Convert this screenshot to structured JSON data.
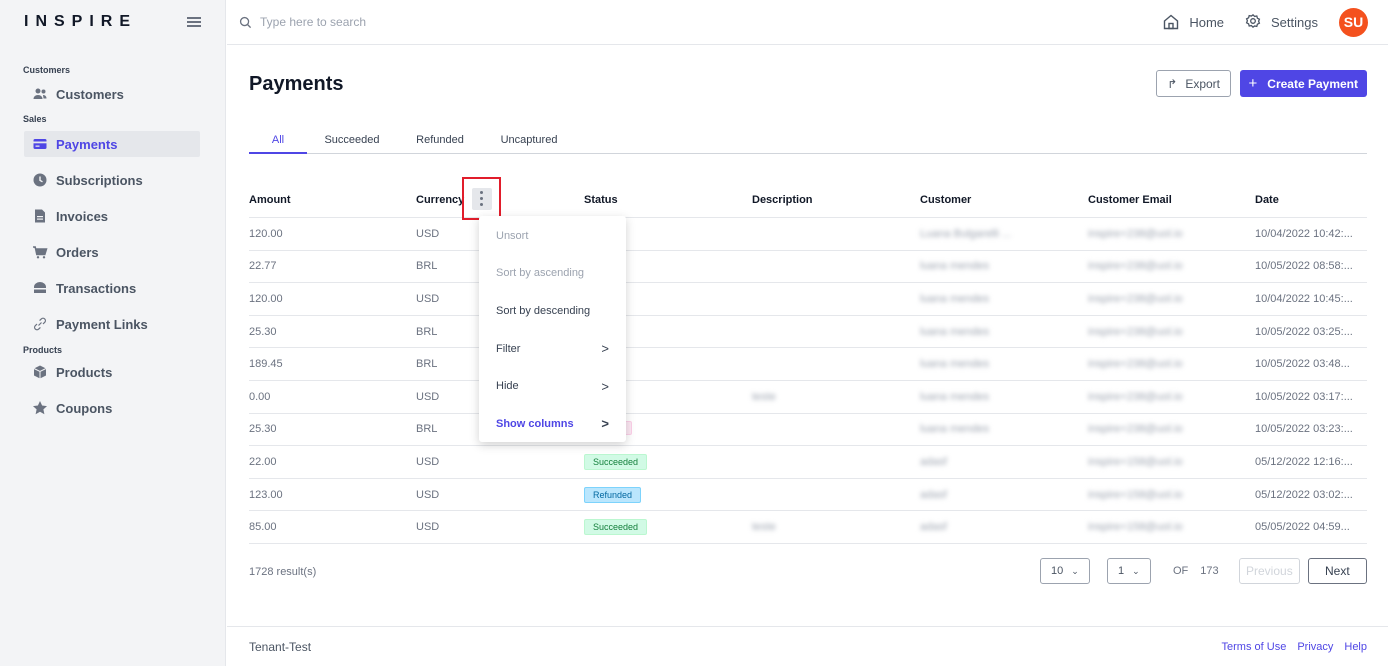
{
  "brand": {
    "logo_pre": "IN",
    "logo_post": "SPIRE"
  },
  "sidebar": {
    "section_customers": "Customers",
    "customers": "Customers",
    "section_sales": "Sales",
    "payments": "Payments",
    "subscriptions": "Subscriptions",
    "invoices": "Invoices",
    "orders": "Orders",
    "transactions": "Transactions",
    "payment_links": "Payment Links",
    "section_products": "Products",
    "products": "Products",
    "coupons": "Coupons"
  },
  "header": {
    "search_placeholder": "Type here to search",
    "home": "Home",
    "settings": "Settings",
    "avatar": "SU"
  },
  "page": {
    "title": "Payments",
    "export": "Export",
    "create": "Create Payment",
    "tabs": [
      "All",
      "Succeeded",
      "Refunded",
      "Uncaptured"
    ]
  },
  "table": {
    "headers": [
      "Amount",
      "Currency",
      "Status",
      "Description",
      "Customer",
      "Customer Email",
      "Date"
    ],
    "rows": [
      {
        "amount": "120.00",
        "currency": "USD",
        "status": "ded",
        "description": "",
        "customer": "Luana Bulgarelli ...",
        "email": "inspire+238@uol.io",
        "date": "10/04/2022 10:42:..."
      },
      {
        "amount": "22.77",
        "currency": "BRL",
        "status": "ded",
        "description": "",
        "customer": "luana mendes",
        "email": "inspire+238@uol.io",
        "date": "10/05/2022 08:58:..."
      },
      {
        "amount": "120.00",
        "currency": "USD",
        "status": "ded",
        "description": "",
        "customer": "luana mendes",
        "email": "inspire+238@uol.io",
        "date": "10/04/2022 10:45:..."
      },
      {
        "amount": "25.30",
        "currency": "BRL",
        "status": "ded",
        "description": "",
        "customer": "luana mendes",
        "email": "inspire+238@uol.io",
        "date": "10/05/2022 03:25:..."
      },
      {
        "amount": "189.45",
        "currency": "BRL",
        "status": "ded",
        "description": "",
        "customer": "luana mendes",
        "email": "inspire+238@uol.io",
        "date": "10/05/2022 03:48..."
      },
      {
        "amount": "0.00",
        "currency": "USD",
        "status": "ded",
        "description": "teste",
        "customer": "luana mendes",
        "email": "inspire+238@uol.io",
        "date": "10/05/2022 03:17:..."
      },
      {
        "amount": "25.30",
        "currency": "BRL",
        "status": "",
        "description": "",
        "customer": "luana mendes",
        "email": "inspire+238@uol.io",
        "date": "10/05/2022 03:23:..."
      },
      {
        "amount": "22.00",
        "currency": "USD",
        "status": "Succeeded",
        "description": "",
        "customer": "adasf",
        "email": "inspire+158@uol.io",
        "date": "05/12/2022 12:16:..."
      },
      {
        "amount": "123.00",
        "currency": "USD",
        "status": "Refunded",
        "description": "",
        "customer": "adasf",
        "email": "inspire+158@uol.io",
        "date": "05/12/2022 03:02:..."
      },
      {
        "amount": "85.00",
        "currency": "USD",
        "status": "Succeeded",
        "description": "teste",
        "customer": "adasf",
        "email": "inspire+158@uol.io",
        "date": "05/05/2022 04:59..."
      }
    ]
  },
  "menu": {
    "unsort": "Unsort",
    "asc": "Sort by ascending",
    "desc": "Sort by descending",
    "filter": "Filter",
    "hide": "Hide",
    "show_columns": "Show columns",
    "chevron": ">"
  },
  "pagination": {
    "results": "1728 result(s)",
    "page_size": "10",
    "page": "1",
    "of_label": "OF",
    "total_pages": "173",
    "previous": "Previous",
    "next": "Next"
  },
  "footer": {
    "tenant": "Tenant-Test",
    "terms": "Terms of Use",
    "privacy": "Privacy",
    "help": "Help"
  },
  "colors": {
    "accent": "#4f46e5",
    "avatar": "#f4511e",
    "highlight": "#e11d2b"
  }
}
